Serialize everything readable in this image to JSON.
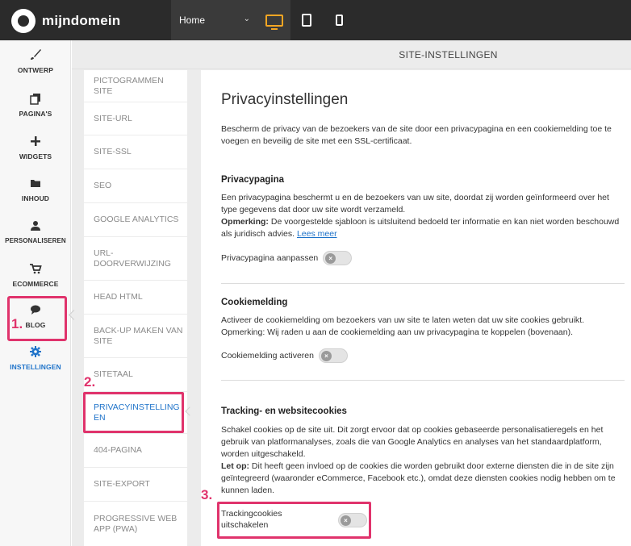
{
  "topbar": {
    "logo_text": "mijndomein",
    "page_select": "Home",
    "devices": [
      "desktop-icon",
      "tablet-icon",
      "mobile-icon"
    ],
    "active_device": "desktop",
    "accent_color": "#f5a623"
  },
  "sidebar": {
    "items": [
      {
        "label": "ONTWERP",
        "icon": "brush-icon"
      },
      {
        "label": "PAGINA'S",
        "icon": "pages-icon"
      },
      {
        "label": "WIDGETS",
        "icon": "plus-icon"
      },
      {
        "label": "INHOUD",
        "icon": "folder-icon"
      },
      {
        "label": "PERSONALISEREN",
        "icon": "user-icon"
      },
      {
        "label": "ECOMMERCE",
        "icon": "cart-icon"
      },
      {
        "label": "BLOG",
        "icon": "chat-icon"
      },
      {
        "label": "INSTELLINGEN",
        "icon": "gear-icon"
      }
    ],
    "active": "INSTELLINGEN"
  },
  "header": {
    "title": "SITE-INSTELLINGEN"
  },
  "settings_menu": {
    "items": [
      "PICTOGRAMMEN SITE",
      "SITE-URL",
      "SITE-SSL",
      "SEO",
      "GOOGLE ANALYTICS",
      "URL-DOORVERWIJZING",
      "HEAD HTML",
      "BACK-UP MAKEN VAN SITE",
      "SITETAAL",
      "PRIVACYINSTELLINGEN",
      "404-PAGINA",
      "SITE-EXPORT",
      "PROGRESSIVE WEB APP (PWA)"
    ],
    "active": "PRIVACYINSTELLINGEN"
  },
  "content": {
    "title": "Privacyinstellingen",
    "intro": "Bescherm de privacy van de bezoekers van de site door een privacypagina en een cookiemelding toe te voegen en beveilig de site met een SSL-certificaat.",
    "privacy": {
      "heading": "Privacypagina",
      "text": "Een privacypagina beschermt u en de bezoekers van uw site, doordat zij worden geïnformeerd over het type gegevens dat door uw site wordt verzameld.",
      "note_label": "Opmerking:",
      "note": "De voorgestelde sjabloon is uitsluitend bedoeld ter informatie en kan niet worden beschouwd als juridisch advies.",
      "link": "Lees meer",
      "toggle_label": "Privacypagina aanpassen",
      "toggle_on": false
    },
    "cookie": {
      "heading": "Cookiemelding",
      "text": "Activeer de cookiemelding om bezoekers van uw site te laten weten dat uw site cookies gebruikt.",
      "text2": "Opmerking: Wij raden u aan de cookiemelding aan uw privacypagina te koppelen (bovenaan).",
      "toggle_label": "Cookiemelding activeren",
      "toggle_on": false
    },
    "tracking": {
      "heading": "Tracking- en websitecookies",
      "text": "Schakel cookies op de site uit. Dit zorgt ervoor dat op cookies gebaseerde personalisatieregels en het gebruik van platformanalyses, zoals die van Google Analytics en analyses van het standaardplatform, worden uitgeschakeld.",
      "note_label": "Let op:",
      "note": "Dit heeft geen invloed op de cookies die worden gebruikt door externe diensten die in de site zijn geïntegreerd (waaronder eCommerce, Facebook etc.), omdat deze diensten cookies nodig hebben om te kunnen laden.",
      "toggle_label": "Trackingcookies uitschakelen",
      "toggle_on": false
    }
  },
  "steps": [
    "1.",
    "2.",
    "3."
  ],
  "highlight_color": "#e0336c",
  "link_color": "#1d72c9"
}
